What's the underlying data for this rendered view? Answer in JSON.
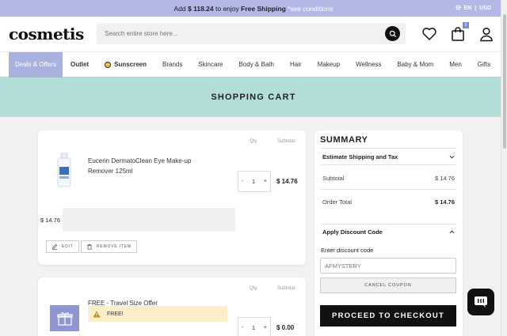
{
  "promo": {
    "add_label": "Add",
    "amount": "$ 118.24",
    "mid_text": "to enjoy",
    "free_shipping": "Free Shipping",
    "conditions": "*see conditions",
    "lang": "EN",
    "sep": "|",
    "currency": "USD"
  },
  "header": {
    "logo": "cosmetis",
    "search_placeholder": "Search entire store here...",
    "cart_count": "0"
  },
  "nav": {
    "deals": "Deals & Offers",
    "outlet": "Outlet",
    "sunscreen": "Sunscreen",
    "brands": "Brands",
    "skincare": "Skincare",
    "body_bath": "Body & Bath",
    "hair": "Hair",
    "makeup": "Makeup",
    "wellness": "Wellness",
    "baby_mom": "Baby & Mom",
    "men": "Men",
    "gifts": "Gifts"
  },
  "page": {
    "title": "SHOPPING CART"
  },
  "cart": {
    "qty_header": "Qty",
    "subtotal_header": "Subtotal",
    "items": [
      {
        "name": "Eucerin DermatoClean Eye Make-up Remover 125ml",
        "qty": "1",
        "price": "$ 14.76",
        "line_price": "$ 14.76",
        "edit_label": "EDIT",
        "remove_label": "REMOVE ITEM"
      },
      {
        "name": "FREE - Travel Size Offer",
        "notice": "FREE!",
        "qty": "1",
        "price": "$ 0.00"
      }
    ],
    "minus": "-",
    "plus": "+"
  },
  "summary": {
    "title": "SUMMARY",
    "estimate": "Estimate Shipping and Tax",
    "subtotal_label": "Subtotal",
    "subtotal_value": "$ 14.76",
    "order_total_label": "Order Total",
    "order_total_value": "$ 14.76",
    "discount_toggle": "Apply Discount Code",
    "discount_label": "Enter discount code",
    "discount_value": "AFMYSTERY",
    "cancel_coupon": "CANCEL COUPON",
    "checkout": "PROCEED TO CHECKOUT"
  }
}
